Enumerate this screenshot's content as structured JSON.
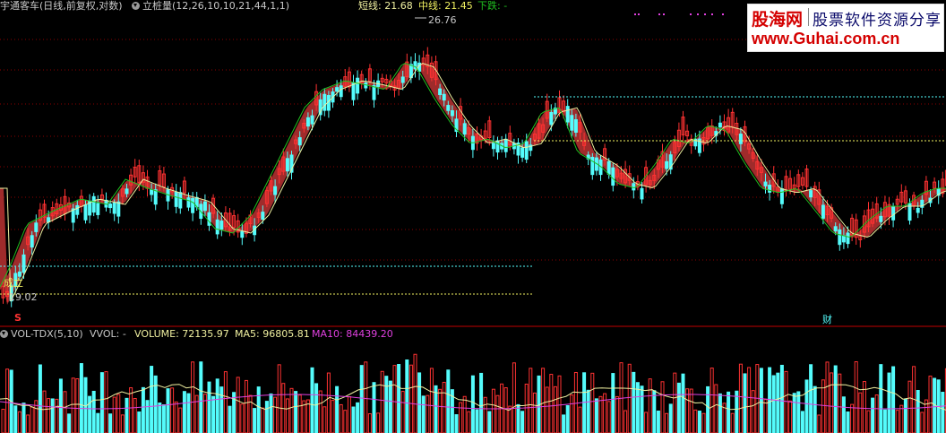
{
  "header": {
    "stock_title": "宇通客车(日线,前复权,对数)",
    "indicator_name": "立桩量(12,26,10,10,21,44,1,1)",
    "short_label": "短线: 21.68",
    "mid_label": "中线: 21.45",
    "down_label": "下跌: -"
  },
  "price_annotations": {
    "high_price": "26.76",
    "low_price": "19.02",
    "chengli_label": "成立",
    "s_marker": "S",
    "cai_marker": "财"
  },
  "volume_header": {
    "indicator": "VOL-TDX(5,10)",
    "vvol": "VVOL: -",
    "volume": "VOLUME: 72135.97",
    "ma5": "MA5: 96805.81",
    "ma10": "MA10: 84439.20"
  },
  "watermark": {
    "brand": "股海网",
    "slogan": "股票软件资源分享",
    "url": "www.Guhai.com.cn"
  },
  "colors": {
    "up": "#ff3232",
    "down": "#54fcfc",
    "band": "#b03030",
    "ma_yellow": "#f0f0a0",
    "ma_green": "#20c020",
    "ma10_magenta": "#e040e0",
    "grid": "#8b0000"
  },
  "icons": {
    "indicator_toggle": "chevron-circle-icon"
  }
}
